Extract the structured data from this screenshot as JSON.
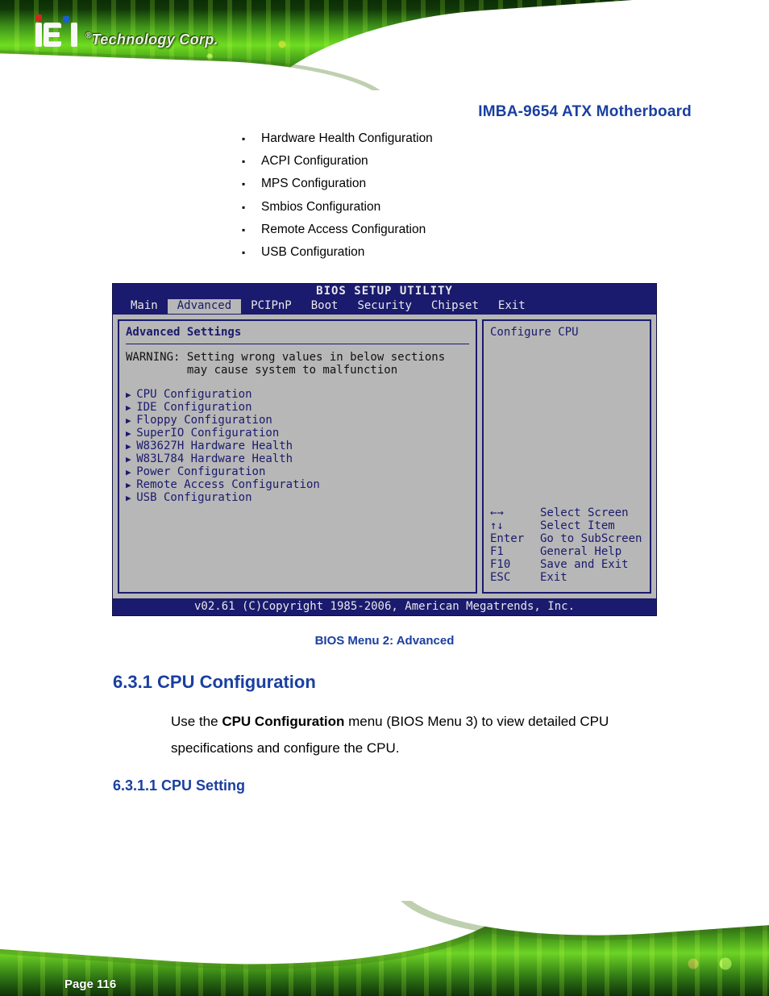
{
  "header": {
    "logo_text": "Technology Corp.",
    "product": "IMBA-9654 ATX Motherboard"
  },
  "bullets": [
    "Hardware Health Configuration",
    "ACPI Configuration",
    "MPS Configuration",
    "Smbios Configuration",
    "Remote Access Configuration",
    "USB Configuration"
  ],
  "bios": {
    "title": "BIOS SETUP UTILITY",
    "tabs": [
      "Main",
      "Advanced",
      "PCIPnP",
      "Boot",
      "Security",
      "Chipset",
      "Exit"
    ],
    "active_tab": "Advanced",
    "left_panel_title": "Advanced Settings",
    "warning_line1": "WARNING: Setting wrong values in below sections",
    "warning_line2": "         may cause system to malfunction",
    "submenus": [
      "CPU Configuration",
      "IDE Configuration",
      "Floppy Configuration",
      "SuperIO Configuration",
      "W83627H Hardware Health",
      "W83L784 Hardware Health",
      "Power Configuration",
      "Remote Access Configuration",
      "USB Configuration"
    ],
    "right_panel_top": "Configure CPU",
    "help": [
      {
        "key": "←→",
        "label": "Select Screen"
      },
      {
        "key": "↑↓",
        "label": "Select Item"
      },
      {
        "key": "Enter",
        "label": "Go to SubScreen"
      },
      {
        "key": "F1",
        "label": "General Help"
      },
      {
        "key": "F10",
        "label": "Save and Exit"
      },
      {
        "key": "ESC",
        "label": "Exit"
      }
    ],
    "footer": "v02.61 (C)Copyright 1985-2006, American Megatrends, Inc."
  },
  "figure_caption": "BIOS Menu 2: Advanced",
  "section": {
    "heading": "6.3.1 CPU Configuration",
    "para_prefix": "Use the ",
    "para_menu": "CPU Configuration",
    "para_mid": " menu (",
    "para_figref": "BIOS Menu 3",
    "para_after": ") to view detailed CPU specifications and configure the CPU.",
    "subheading": "6.3.1.1 CPU Setting"
  },
  "page_number": "Page 116"
}
